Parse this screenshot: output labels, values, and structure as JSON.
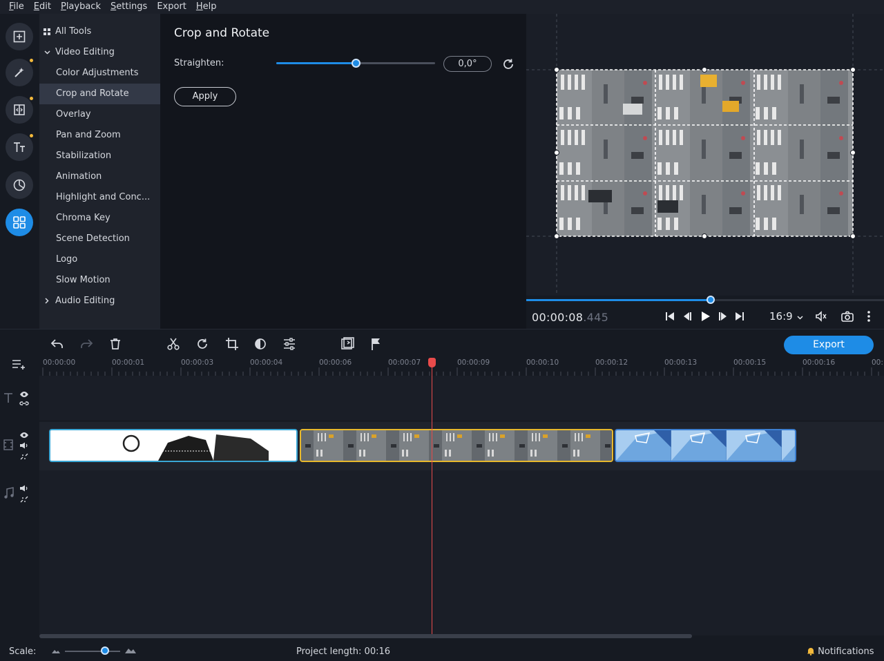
{
  "menubar": {
    "items": [
      {
        "label": "File",
        "underline": "F"
      },
      {
        "label": "Edit",
        "underline": "E"
      },
      {
        "label": "Playback",
        "underline": "P"
      },
      {
        "label": "Settings",
        "underline": "S"
      },
      {
        "label": "Export",
        "underline": ""
      },
      {
        "label": "Help",
        "underline": "H"
      }
    ]
  },
  "rail": {
    "icons": [
      "add-media-icon",
      "magic-wand-icon",
      "transitions-icon",
      "titles-icon",
      "stickers-icon",
      "more-tools-icon"
    ]
  },
  "tools": {
    "all_tools": "All Tools",
    "video_editing": "Video Editing",
    "items": [
      "Color Adjustments",
      "Crop and Rotate",
      "Overlay",
      "Pan and Zoom",
      "Stabilization",
      "Animation",
      "Highlight and Conc...",
      "Chroma Key",
      "Scene Detection",
      "Logo",
      "Slow Motion"
    ],
    "selected_index": 1,
    "audio_editing": "Audio Editing"
  },
  "panel": {
    "title": "Crop and Rotate",
    "straighten_label": "Straighten:",
    "angle_value": "0,0°",
    "straighten_position": 0.5,
    "apply_label": "Apply"
  },
  "player": {
    "timecode_main": "00:00:08",
    "timecode_ms": ".445",
    "progress": 0.516,
    "aspect_ratio": "16:9"
  },
  "toolbar": {
    "export_label": "Export"
  },
  "ruler": {
    "ticks": [
      "00:00:00",
      "00:00:01",
      "00:00:03",
      "00:00:04",
      "00:00:06",
      "00:00:07",
      "00:00:09",
      "00:00:10",
      "00:00:12",
      "00:00:13",
      "00:00:15",
      "00:00:16",
      "00:"
    ]
  },
  "status": {
    "scale_label": "Scale:",
    "scale_level": 0.72,
    "project_length": "Project length:  00:16",
    "notifications": "Notifications"
  },
  "colors": {
    "accent": "#1e8ce6",
    "selected_clip_border": "#e8b92c",
    "playhead": "#e94b4b",
    "notification_dot": "#f3b93b"
  }
}
